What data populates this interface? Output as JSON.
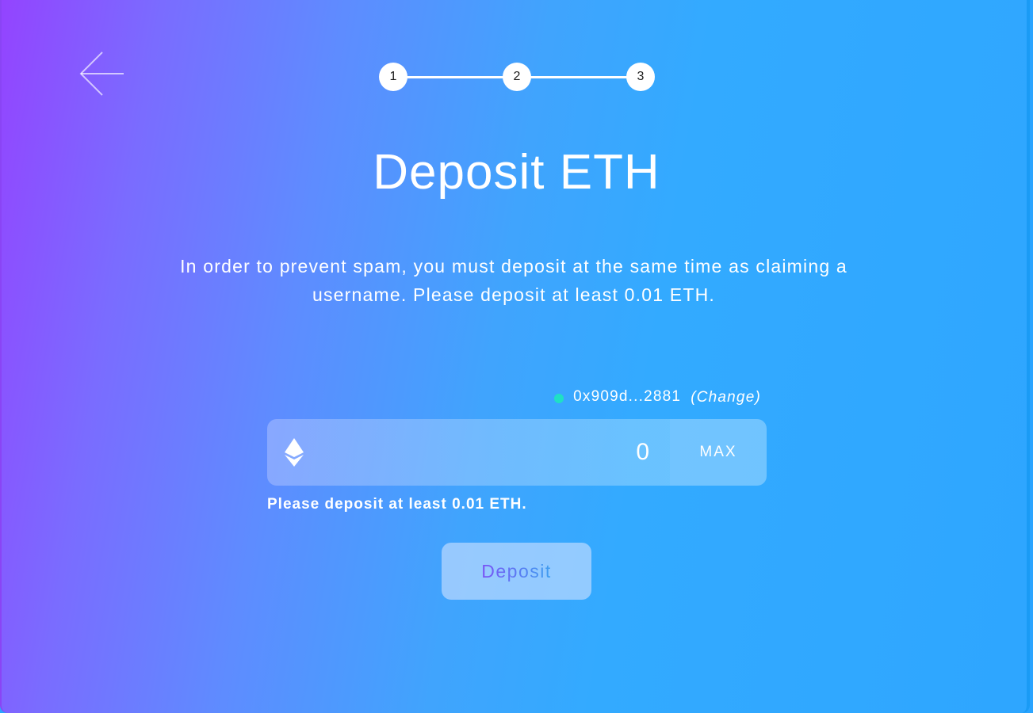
{
  "stepper": {
    "steps": [
      "1",
      "2",
      "3"
    ]
  },
  "page": {
    "title": "Deposit ETH",
    "description": "In order to prevent spam, you must deposit at the same time as claiming a username. Please deposit at least 0.01 ETH."
  },
  "wallet": {
    "address": "0x909d...2881",
    "change_label": "(Change)",
    "status_color": "#1fe0c4"
  },
  "amount": {
    "value": "0",
    "max_label": "MAX",
    "icon": "ethereum-icon"
  },
  "hint": "Please deposit at least 0.01 ETH.",
  "actions": {
    "deposit_label": "Deposit"
  },
  "icons": {
    "back": "arrow-left-icon"
  }
}
